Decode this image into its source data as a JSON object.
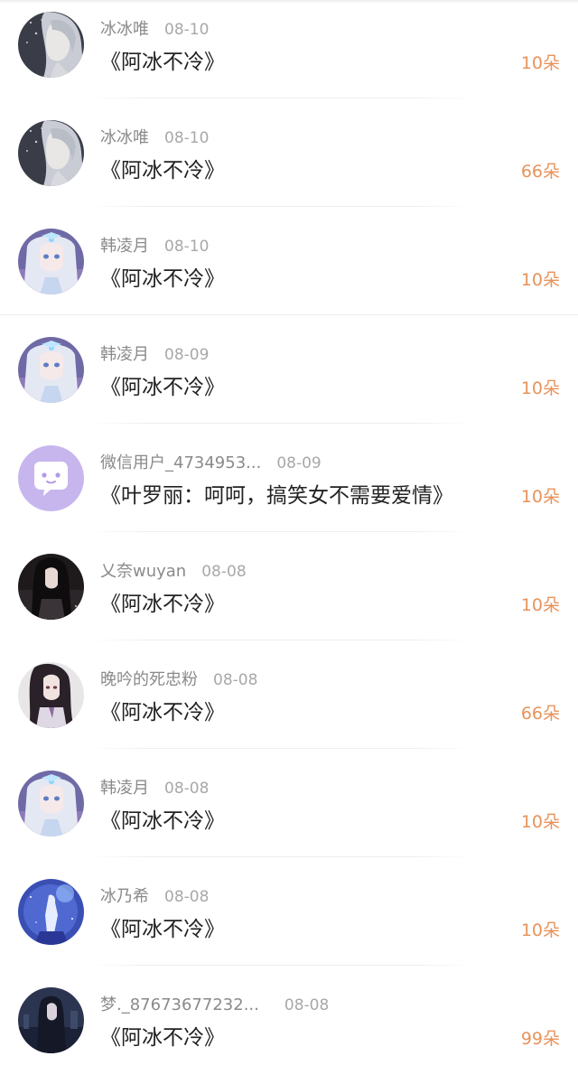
{
  "records": [
    {
      "name": "冰冰唯",
      "date": "08-10",
      "gift": "《阿冰不冷》",
      "amount": "10朵",
      "avatar_icon": "silver-hair-girl-avatar"
    },
    {
      "name": "冰冰唯",
      "date": "08-10",
      "gift": "《阿冰不冷》",
      "amount": "66朵",
      "avatar_icon": "silver-hair-girl-avatar"
    },
    {
      "name": "韩凌月",
      "date": "08-10",
      "gift": "《阿冰不冷》",
      "amount": "10朵",
      "avatar_icon": "ice-princess-avatar"
    },
    {
      "name": "韩凌月",
      "date": "08-09",
      "gift": "《阿冰不冷》",
      "amount": "10朵",
      "avatar_icon": "ice-princess-avatar"
    },
    {
      "name": "微信用户_4734953...",
      "date": "08-09",
      "gift": "《叶罗丽：呵呵，搞笑女不需要爱情》",
      "amount": "10朵",
      "avatar_icon": "wechat-default-avatar"
    },
    {
      "name": "乂奈wuyan",
      "date": "08-08",
      "gift": "《阿冰不冷》",
      "amount": "10朵",
      "avatar_icon": "dark-hair-girl-avatar"
    },
    {
      "name": "晚吟的死忠粉",
      "date": "08-08",
      "gift": "《阿冰不冷》",
      "amount": "66朵",
      "avatar_icon": "long-hair-boy-avatar"
    },
    {
      "name": "韩凌月",
      "date": "08-08",
      "gift": "《阿冰不冷》",
      "amount": "10朵",
      "avatar_icon": "ice-princess-avatar"
    },
    {
      "name": "冰乃希",
      "date": "08-08",
      "gift": "《阿冰不冷》",
      "amount": "10朵",
      "avatar_icon": "night-sky-figure-avatar"
    },
    {
      "name": "梦._87673677232...",
      "date": "08-08",
      "gift": "《阿冰不冷》",
      "amount": "99朵",
      "avatar_icon": "night-city-girl-avatar"
    }
  ],
  "colors": {
    "amount": "#e8935a",
    "name": "#8a8a8a",
    "gift_title": "#222222",
    "wechat_avatar_bg": "#c7b6ee"
  }
}
